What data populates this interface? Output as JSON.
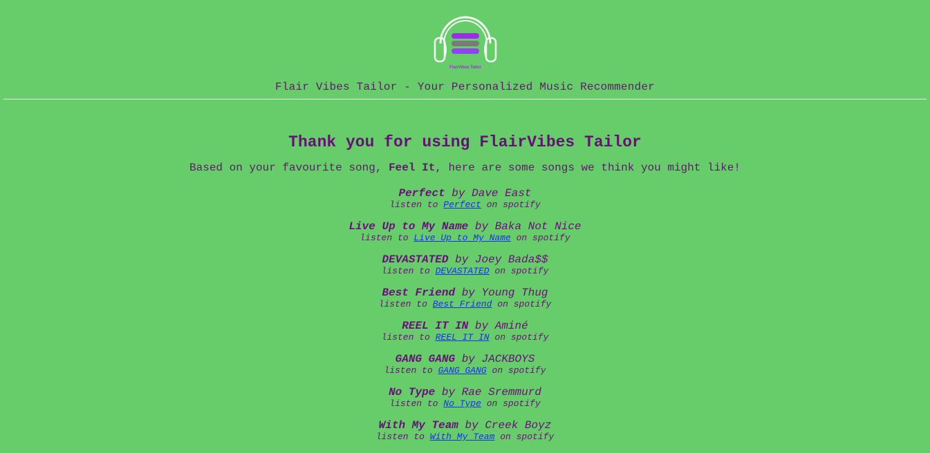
{
  "header": {
    "logo_text": "FlairVibes Tailor",
    "tagline": "Flair Vibes Tailor - Your Personalized Music Recommender"
  },
  "main": {
    "heading": "Thank you for using FlairVibes Tailor",
    "intro_prefix": "Based on your favourite song,",
    "favourite_song": "Feel It",
    "intro_suffix": ", here are some songs we think you might like!",
    "listen_prefix": "listen to",
    "listen_suffix": "on spotify",
    "by_word": "by",
    "songs": [
      {
        "title": "Perfect",
        "artist": "Dave East"
      },
      {
        "title": "Live Up to My Name",
        "artist": "Baka Not Nice"
      },
      {
        "title": "DEVASTATED",
        "artist": "Joey Bada$$"
      },
      {
        "title": "Best Friend",
        "artist": "Young Thug"
      },
      {
        "title": "REEL IT IN",
        "artist": "Aminé"
      },
      {
        "title": "GANG GANG",
        "artist": "JACKBOYS"
      },
      {
        "title": "No Type",
        "artist": "Rae Sremmurd"
      },
      {
        "title": "With My Team",
        "artist": "Creek Boyz"
      }
    ]
  },
  "colors": {
    "background": "#66cd6a",
    "text_purple": "#6a0f7a",
    "link_blue": "#1a2cff",
    "logo_white": "#f4f7f4",
    "logo_purple": "#9b2ee6",
    "logo_gray": "#7a7a7a",
    "logo_violet": "#8e44f0"
  }
}
